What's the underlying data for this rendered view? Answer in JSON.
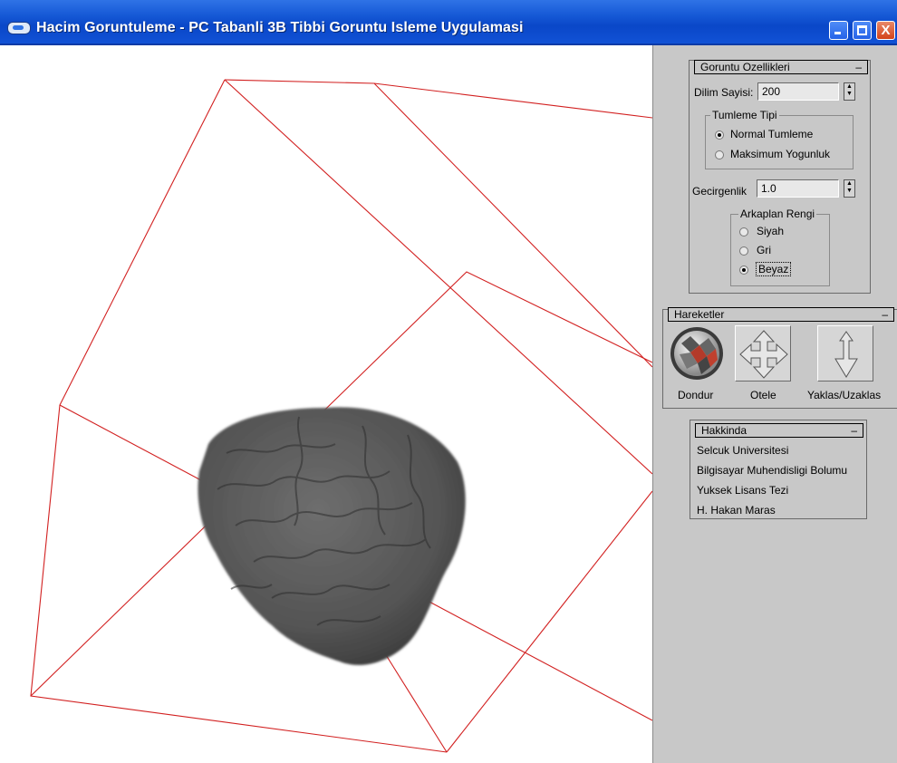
{
  "window": {
    "title": "Hacim Goruntuleme - PC Tabanli 3B Tibbi Goruntu Isleme Uygulamasi",
    "close_glyph": "X"
  },
  "image_props": {
    "title": "Goruntu Ozellikleri",
    "collapse": "–",
    "slice_label": "Dilim Sayisi:",
    "slice_value": "200",
    "render_group": "Tumleme Tipi",
    "render_options": [
      "Normal Tumleme",
      "Maksimum Yogunluk"
    ],
    "render_selected": 0,
    "opacity_label": "Gecirgenlik",
    "opacity_value": "1.0",
    "bg_group": "Arkaplan Rengi",
    "bg_options": [
      "Siyah",
      "Gri",
      "Beyaz"
    ],
    "bg_selected": 2
  },
  "motions": {
    "title": "Hareketler",
    "collapse": "–",
    "tools": [
      {
        "label": "Dondur",
        "icon": "rotate-sphere-icon"
      },
      {
        "label": "Otele",
        "icon": "move-arrows-icon"
      },
      {
        "label": "Yaklas/Uzaklas",
        "icon": "zoom-arrows-icon"
      }
    ]
  },
  "about": {
    "title": "Hakkinda",
    "collapse": "–",
    "lines": [
      "Selcuk Universitesi",
      "Bilgisayar Muhendisligi Bolumu",
      "Yuksek Lisans Tezi",
      "H. Hakan Maras"
    ]
  },
  "colors": {
    "box_lines": "#d22020",
    "brain": "#5a5a5a",
    "panel": "#c8c8c8",
    "titlebar": "#0a47c8"
  }
}
